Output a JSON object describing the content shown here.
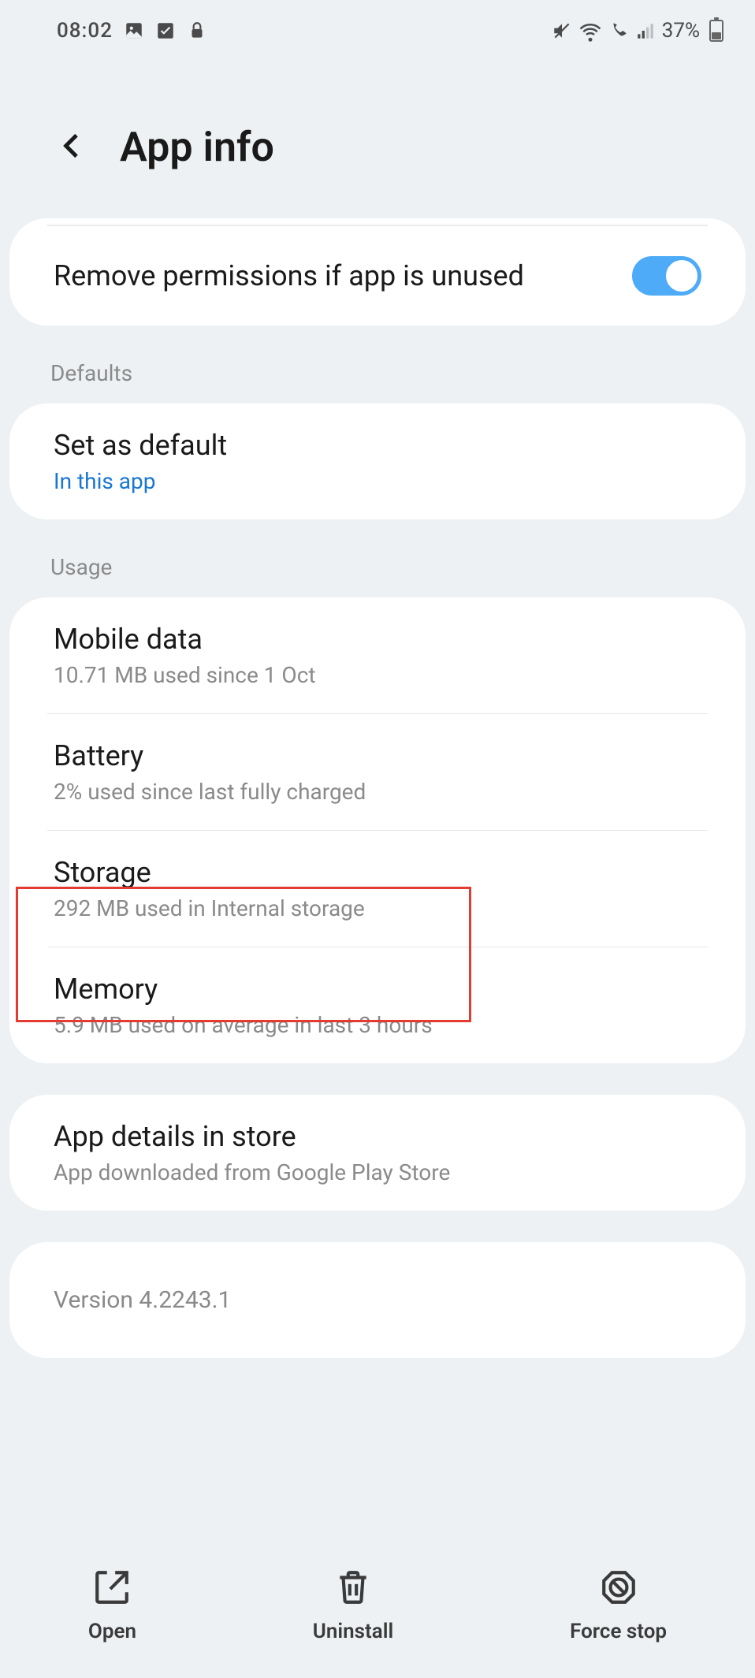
{
  "status_bar": {
    "time": "08:02",
    "battery_pct": "37%"
  },
  "header": {
    "title": "App info"
  },
  "remove_perms": {
    "label": "Remove permissions if app is unused",
    "enabled": true
  },
  "sections": {
    "defaults_label": "Defaults",
    "usage_label": "Usage"
  },
  "defaults": {
    "title": "Set as default",
    "subtitle": "In this app"
  },
  "usage": {
    "mobile_data": {
      "title": "Mobile data",
      "subtitle": "10.71 MB used since 1 Oct"
    },
    "battery": {
      "title": "Battery",
      "subtitle": "2% used since last fully charged"
    },
    "storage": {
      "title": "Storage",
      "subtitle": "292 MB used in Internal storage"
    },
    "memory": {
      "title": "Memory",
      "subtitle": "5.9 MB used on average in last 3 hours"
    }
  },
  "store": {
    "title": "App details in store",
    "subtitle": "App downloaded from Google Play Store"
  },
  "version": "Version 4.2243.1",
  "bottom": {
    "open": "Open",
    "uninstall": "Uninstall",
    "force_stop": "Force stop"
  }
}
